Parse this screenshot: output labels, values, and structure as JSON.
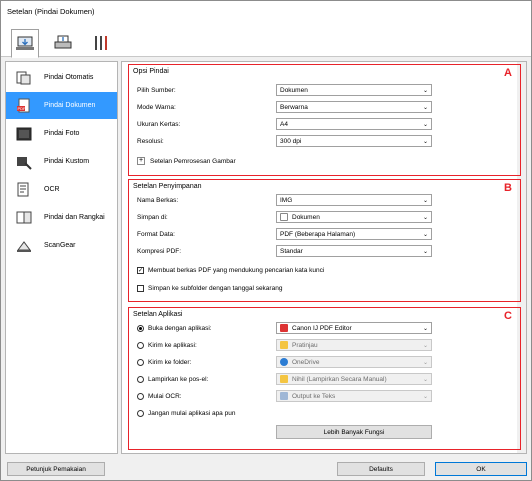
{
  "window": {
    "title": "Setelan (Pindai Dokumen)"
  },
  "toolbar": {
    "tabs": [
      "scan-from-computer-icon",
      "scan-from-panel-icon",
      "general-settings-icon"
    ]
  },
  "sidebar": {
    "items": [
      {
        "label": "Pindai Otomatis",
        "icon": "auto-scan-icon"
      },
      {
        "label": "Pindai Dokumen",
        "icon": "document-scan-icon",
        "selected": true
      },
      {
        "label": "Pindai Foto",
        "icon": "photo-scan-icon"
      },
      {
        "label": "Pindai Kustom",
        "icon": "custom-scan-icon"
      },
      {
        "label": "OCR",
        "icon": "ocr-icon"
      },
      {
        "label": "Pindai dan Rangkai",
        "icon": "stitch-icon"
      },
      {
        "label": "ScanGear",
        "icon": "scangear-icon"
      }
    ]
  },
  "scan_options": {
    "title": "Opsi Pindai",
    "letter": "A",
    "source_label": "Pilih Sumber:",
    "source_value": "Dokumen",
    "color_mode_label": "Mode Warna:",
    "color_mode_value": "Berwarna",
    "paper_size_label": "Ukuran Kertas:",
    "paper_size_value": "A4",
    "resolution_label": "Resolusi:",
    "resolution_value": "300 dpi",
    "image_processing_label": "Setelan Pemrosesan Gambar"
  },
  "save_settings": {
    "title": "Setelan Penyimpanan",
    "letter": "B",
    "file_name_label": "Nama Berkas:",
    "file_name_value": "IMG",
    "save_in_label": "Simpan di:",
    "save_in_value": "Dokumen",
    "data_format_label": "Format Data:",
    "data_format_value": "PDF (Beberapa Halaman)",
    "pdf_compression_label": "Kompresi PDF:",
    "pdf_compression_value": "Standar",
    "searchable_pdf_label": "Membuat berkas PDF yang mendukung pencarian kata kunci",
    "subfolder_label": "Simpan ke subfolder dengan tanggal sekarang"
  },
  "app_settings": {
    "title": "Setelan Aplikasi",
    "letter": "C",
    "open_with_label": "Buka dengan aplikasi:",
    "open_with_value": "Canon IJ PDF Editor",
    "send_to_app_label": "Kirim ke aplikasi:",
    "send_to_app_value": "Pratinjau",
    "send_to_folder_label": "Kirim ke folder:",
    "send_to_folder_value": "OneDrive",
    "attach_email_label": "Lampirkan ke pos-el:",
    "attach_email_value": "Nihil (Lampirkan Secara Manual)",
    "start_ocr_label": "Mulai OCR:",
    "start_ocr_value": "Output ke Teks",
    "no_app_label": "Jangan mulai aplikasi apa pun",
    "more_functions_label": "Lebih Banyak Fungsi"
  },
  "footer": {
    "guide_label": "Petunjuk Pemakaian",
    "defaults_label": "Defaults",
    "ok_label": "OK"
  },
  "colors": {
    "selection": "#3399ff",
    "highlight_box": "#e8232a"
  }
}
